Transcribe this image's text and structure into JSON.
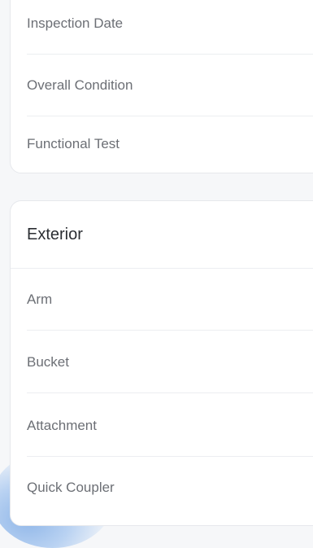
{
  "inspection_card": {
    "items": [
      {
        "label": "Inspection Date"
      },
      {
        "label": "Overall Condition"
      },
      {
        "label": "Functional Test"
      }
    ]
  },
  "exterior_card": {
    "title": "Exterior",
    "items": [
      {
        "label": "Arm"
      },
      {
        "label": "Bucket"
      },
      {
        "label": "Attachment"
      },
      {
        "label": "Quick Coupler"
      }
    ]
  }
}
